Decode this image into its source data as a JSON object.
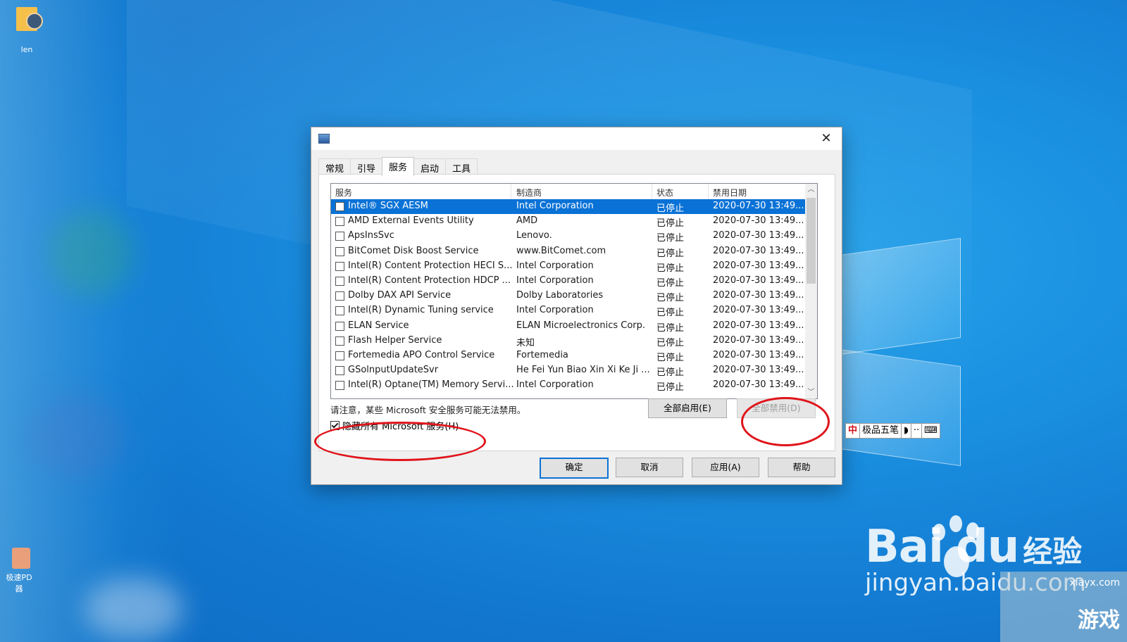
{
  "desktop": {
    "icons": [
      {
        "label": "len"
      },
      {
        "label": "极速PD 器"
      }
    ],
    "ime_bar": {
      "lang": "中",
      "label": "极品五笔",
      "moon": "◗",
      "dots": "··",
      "keyboard": "⌨"
    },
    "watermark": {
      "brand": "Bai",
      "brand_du": "du",
      "brand_cn": "经验",
      "url": "jingyan.baidu.com",
      "site_small": "xiayx.com",
      "site_cn": "游戏"
    }
  },
  "dialog": {
    "close_glyph": "✕",
    "tabs": [
      "常规",
      "引导",
      "服务",
      "启动",
      "工具"
    ],
    "active_tab": "服务",
    "columns": {
      "service": "服务",
      "vendor": "制造商",
      "status": "状态",
      "date": "禁用日期"
    },
    "rows": [
      {
        "name": "Intel® SGX AESM",
        "vendor": "Intel Corporation",
        "status": "已停止",
        "date": "2020-07-30 13:49..."
      },
      {
        "name": "AMD External Events Utility",
        "vendor": "AMD",
        "status": "已停止",
        "date": "2020-07-30 13:49..."
      },
      {
        "name": "ApsInsSvc",
        "vendor": "Lenovo.",
        "status": "已停止",
        "date": "2020-07-30 13:49..."
      },
      {
        "name": "BitComet Disk Boost Service",
        "vendor": "www.BitComet.com",
        "status": "已停止",
        "date": "2020-07-30 13:49..."
      },
      {
        "name": "Intel(R) Content Protection HECI S...",
        "vendor": "Intel Corporation",
        "status": "已停止",
        "date": "2020-07-30 13:49..."
      },
      {
        "name": "Intel(R) Content Protection HDCP ...",
        "vendor": "Intel Corporation",
        "status": "已停止",
        "date": "2020-07-30 13:49..."
      },
      {
        "name": "Dolby DAX API Service",
        "vendor": "Dolby Laboratories",
        "status": "已停止",
        "date": "2020-07-30 13:49..."
      },
      {
        "name": "Intel(R) Dynamic Tuning service",
        "vendor": "Intel Corporation",
        "status": "已停止",
        "date": "2020-07-30 13:49..."
      },
      {
        "name": "ELAN Service",
        "vendor": "ELAN Microelectronics Corp.",
        "status": "已停止",
        "date": "2020-07-30 13:49..."
      },
      {
        "name": "Flash Helper Service",
        "vendor": "未知",
        "status": "已停止",
        "date": "2020-07-30 13:49..."
      },
      {
        "name": "Fortemedia APO Control Service",
        "vendor": "Fortemedia",
        "status": "已停止",
        "date": "2020-07-30 13:49..."
      },
      {
        "name": "GSolnputUpdateSvr",
        "vendor": "He Fei Yun Biao Xin Xi Ke Ji ...",
        "status": "已停止",
        "date": "2020-07-30 13:49..."
      },
      {
        "name": "Intel(R) Optane(TM) Memory Servi...",
        "vendor": "Intel Corporation",
        "status": "已停止",
        "date": "2020-07-30 13:49..."
      }
    ],
    "note": "请注意，某些 Microsoft 安全服务可能无法禁用。",
    "enable_all": "全部启用(E)",
    "disable_all": "全部禁用(D)",
    "hide_ms_label": "隐藏所有 Microsoft 服务(H)",
    "hide_ms_checked": true,
    "ok": "确定",
    "cancel": "取消",
    "apply": "应用(A)",
    "help": "帮助"
  }
}
